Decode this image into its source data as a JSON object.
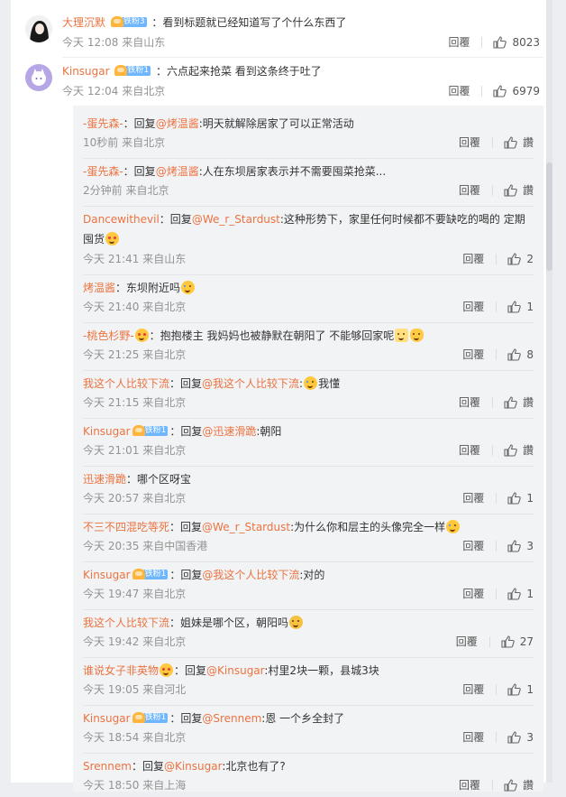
{
  "comments": [
    {
      "name": "大理沉默",
      "fan_level": "铁粉3",
      "text": "：看到标题就已经知道写了个什么东西了",
      "time": "今天 12:08 来自山东",
      "reply_label": "回覆",
      "likes": "8023",
      "avatar_icon": "user-avatar-dark-hair"
    },
    {
      "name": "Kinsugar",
      "fan_level": "铁粉1",
      "text": "：六点起来抢菜 看到这条终于吐了",
      "time": "今天 12:04 来自北京",
      "reply_label": "回覆",
      "likes": "6979",
      "avatar_icon": "user-avatar-purple-cat"
    }
  ],
  "replies": [
    {
      "name": "-蛋先森-",
      "pre": "：回复",
      "at": "@烤温酱",
      "text": ":明天就解除居家了可以正常活动",
      "time": "10秒前 来自北京",
      "reply_label": "回覆",
      "likes": "讚"
    },
    {
      "name": "-蛋先森-",
      "pre": "：回复",
      "at": "@烤温酱",
      "text": ":人在东坝居家表示并不需要囤菜抢菜...",
      "time": "2分钟前 来自北京",
      "reply_label": "回覆",
      "likes": "讚"
    },
    {
      "name": "Dancewithevil",
      "pre": "：回复",
      "at": "@We_r_Stardust",
      "text": ":这种形势下，家里任何时候都不要缺吃的喝的 定期囤货",
      "time": "今天 21:41 来自山东",
      "reply_label": "回覆",
      "likes": "2",
      "emoji": "love"
    },
    {
      "name": "烤温酱",
      "pre": "：东坝附近吗",
      "at": "",
      "text": "",
      "time": "今天 21:40 来自北京",
      "reply_label": "回覆",
      "likes": "1",
      "emoji": "cry"
    },
    {
      "name": "-桃色杉野-",
      "pre": "：抱抱楼主 我妈妈也被静默在朝阳了 不能够回家呢",
      "at": "",
      "text": "",
      "time": "今天 21:25 来自北京",
      "reply_label": "回覆",
      "likes": "8",
      "emoji": "cat",
      "emoji2": "hug",
      "badge": true
    },
    {
      "name": "我这个人比较下流",
      "pre": "：回复",
      "at": "@我这个人比较下流",
      "text": ":",
      "text2": "我懂",
      "time": "今天 21:15 来自北京",
      "reply_label": "回覆",
      "likes": "讚",
      "emoji_mid": "cry"
    },
    {
      "name": "Kinsugar",
      "pre": "：回复",
      "at": "@迅速滑跪",
      "text": ":朝阳",
      "time": "今天 21:01 来自北京",
      "reply_label": "回覆",
      "likes": "讚",
      "fan": "铁粉1"
    },
    {
      "name": "迅速滑跪",
      "pre": "：哪个区呀宝",
      "at": "",
      "text": "",
      "time": "今天 20:57 来自北京",
      "reply_label": "回覆",
      "likes": "1"
    },
    {
      "name": "不三不四混吃等死",
      "pre": "：回复",
      "at": "@We_r_Stardust",
      "text": ":为什么你和层主的头像完全一样",
      "time": "今天 20:35 来自中国香港",
      "reply_label": "回覆",
      "likes": "3",
      "emoji": "cry"
    },
    {
      "name": "Kinsugar",
      "pre": "：回复",
      "at": "@我这个人比较下流",
      "text": ":对的",
      "time": "今天 19:47 来自北京",
      "reply_label": "回覆",
      "likes": "1",
      "fan": "铁粉1"
    },
    {
      "name": "我这个人比较下流",
      "pre": "：姐妹是哪个区，朝阳吗",
      "at": "",
      "text": "",
      "time": "今天 19:42 来自北京",
      "reply_label": "回覆",
      "likes": "27",
      "emoji": "blue"
    },
    {
      "name": "谁说女子非英物",
      "pre": "：回复",
      "at": "@Kinsugar",
      "text": ":村里2块一颗，县城3块",
      "time": "今天 19:05 来自河北",
      "reply_label": "回覆",
      "likes": "1",
      "badge": true
    },
    {
      "name": "Kinsugar",
      "pre": "：回复",
      "at": "@Srennem",
      "text": ":恩 一个乡全封了",
      "time": "今天 18:54 来自北京",
      "reply_label": "回覆",
      "likes": "3",
      "fan": "铁粉1"
    },
    {
      "name": "Srennem",
      "pre": "：回复",
      "at": "@Kinsugar",
      "text": ":北京也有了?",
      "time": "今天 18:50 来自上海",
      "reply_label": "回覆",
      "likes": "讚"
    }
  ]
}
